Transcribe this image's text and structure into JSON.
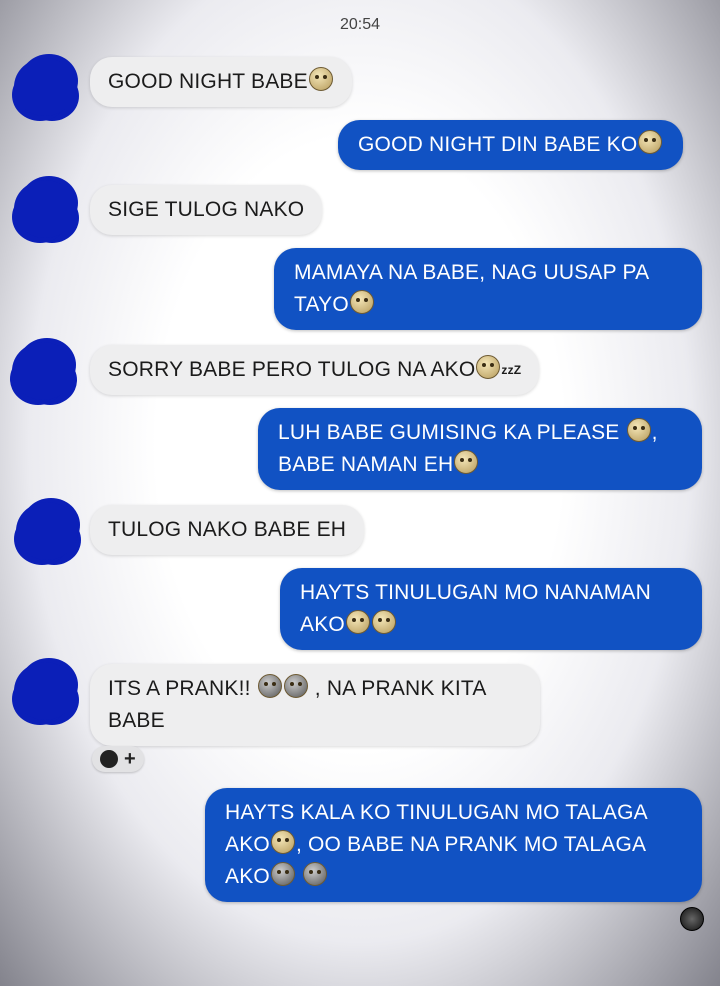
{
  "status_bar": {
    "time": "20:54"
  },
  "messages": [
    {
      "side": "in",
      "text": "GOOD NIGHT BABE",
      "emojis": [
        "smiling-face-with-hearts"
      ]
    },
    {
      "side": "out",
      "text": "GOOD NIGHT DIN BABE KO",
      "emojis": [
        "pleading-face"
      ]
    },
    {
      "side": "in",
      "text": "SIGE TULOG NAKO",
      "emojis": []
    },
    {
      "side": "out",
      "text1": "MAMAYA NA BABE, NAG UUSAP PA",
      "text2": "TAYO",
      "emojis": [
        "pensive-face"
      ]
    },
    {
      "side": "in",
      "text": "SORRY BABE PERO TULOG NA AKO",
      "suffix": "zzZ",
      "emojis": [
        "sleeping-face"
      ]
    },
    {
      "side": "out",
      "text1": "LUH BABE GUMISING KA PLEASE",
      "text1_end": ",",
      "text2": "BABE NAMAN EH",
      "emojis": [
        "pleading-face",
        "pensive-face"
      ]
    },
    {
      "side": "in",
      "text": "TULOG NAKO BABE EH",
      "emojis": []
    },
    {
      "side": "out",
      "text1": "HAYTS TINULUGAN MO NANAMAN",
      "text2": "AKO",
      "emojis": [
        "pensive-face",
        "pleading-face"
      ]
    },
    {
      "side": "in",
      "text1": "ITS A PRANK!!",
      "text1_end": ", NA PRANK KITA",
      "text2": "BABE",
      "emojis": [
        "rolling-on-floor-laughing",
        "grinning-squinting-face"
      ]
    },
    {
      "side": "out",
      "text1": "HAYTS KALA KO TINULUGAN MO TALAGA",
      "text2a": "AKO",
      "text2b": ", OO BABE NA PRANK MO TALAGA",
      "text3": "AKO",
      "emojis": [
        "pleading-face",
        "rolling-on-floor-laughing",
        "grinning-squinting-face"
      ]
    }
  ],
  "reaction": {
    "icon": "smiley-reaction-icon",
    "plus": "+"
  },
  "colors": {
    "outgoing": "#1152c3",
    "incoming": "#eeeeef",
    "avatar": "#0b1fb8"
  }
}
